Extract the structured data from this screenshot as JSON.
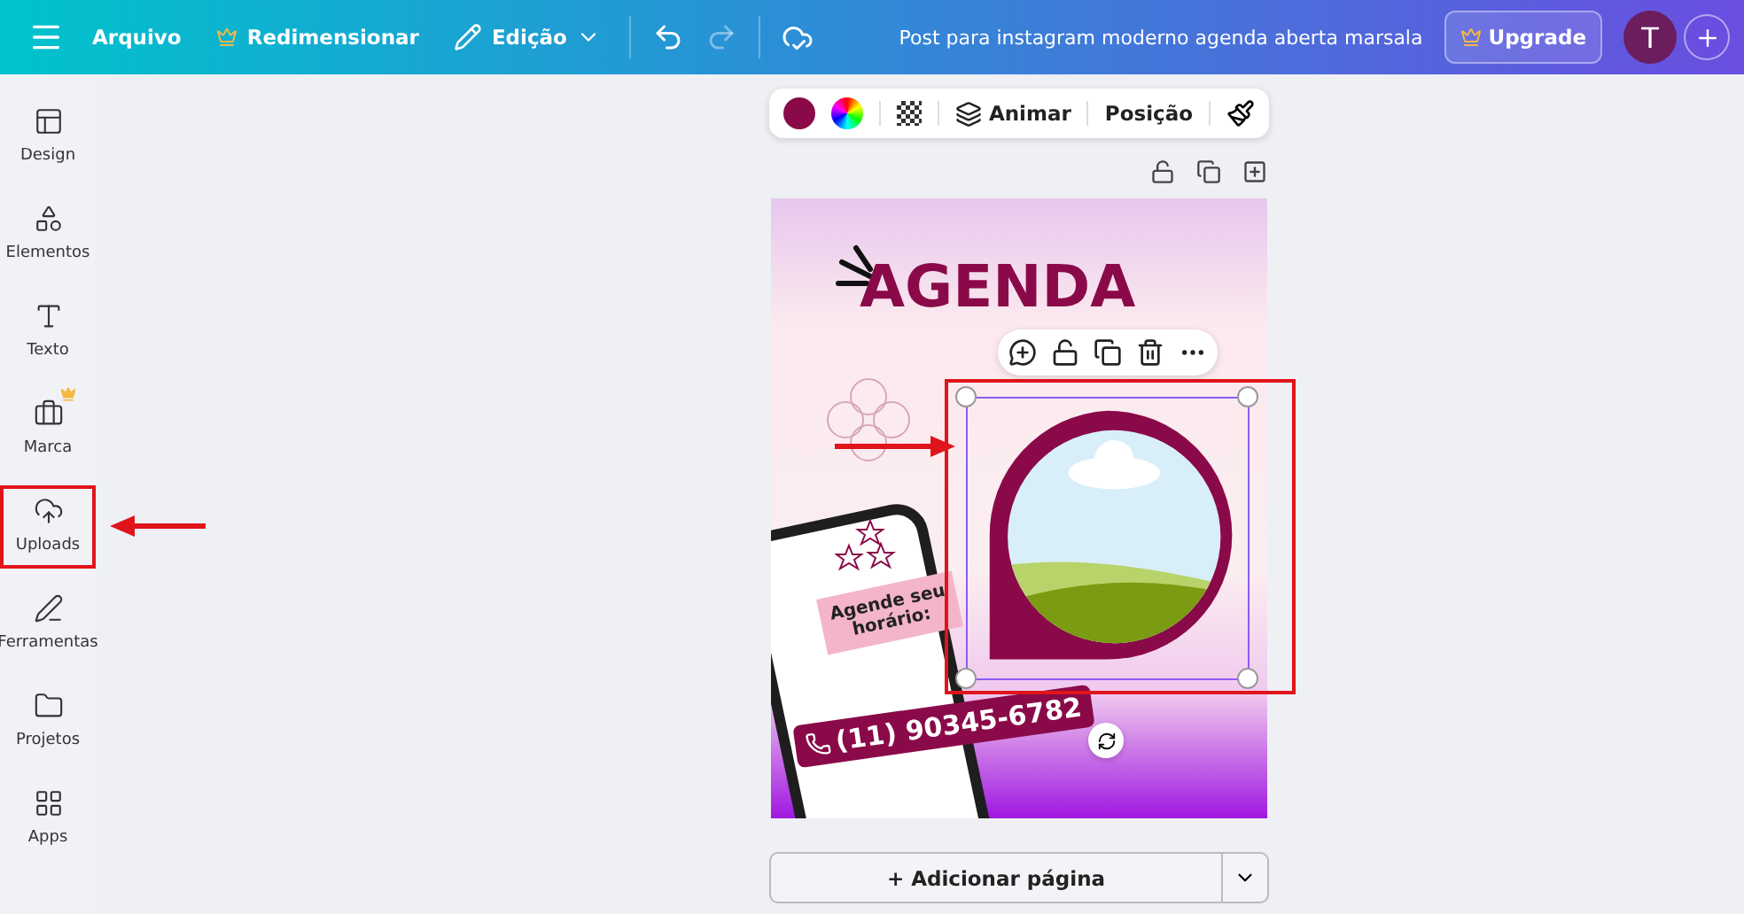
{
  "topbar": {
    "menu": [
      "Arquivo",
      "Redimensionar",
      "Edição"
    ],
    "history_buttons": [
      {
        "disabled": false
      },
      {
        "disabled": true
      }
    ],
    "title": "Post para instagram moderno agenda aberta marsala",
    "upgrade": "Upgrade",
    "avatar": "T"
  },
  "sidebar": {
    "items": [
      {
        "label": "Design",
        "premium": false,
        "highlighted": false
      },
      {
        "label": "Elementos",
        "premium": false,
        "highlighted": false
      },
      {
        "label": "Texto",
        "premium": false,
        "highlighted": false
      },
      {
        "label": "Marca",
        "premium": true,
        "highlighted": false
      },
      {
        "label": "Uploads",
        "premium": false,
        "highlighted": true
      },
      {
        "label": "Ferramentas",
        "premium": false,
        "highlighted": false
      },
      {
        "label": "Projetos",
        "premium": false,
        "highlighted": false
      },
      {
        "label": "Apps",
        "premium": false,
        "highlighted": false
      }
    ]
  },
  "toolbar": {
    "swatches": [
      {
        "color": "#8a0a49"
      }
    ],
    "actions": [
      "Animar",
      "Posição"
    ]
  },
  "design": {
    "headline": "AGENDA",
    "bubble": "Agende seu horário:",
    "phone": "(11) 90345-6782",
    "selection_highlighted": true
  },
  "add_page": "+ Adicionar página"
}
